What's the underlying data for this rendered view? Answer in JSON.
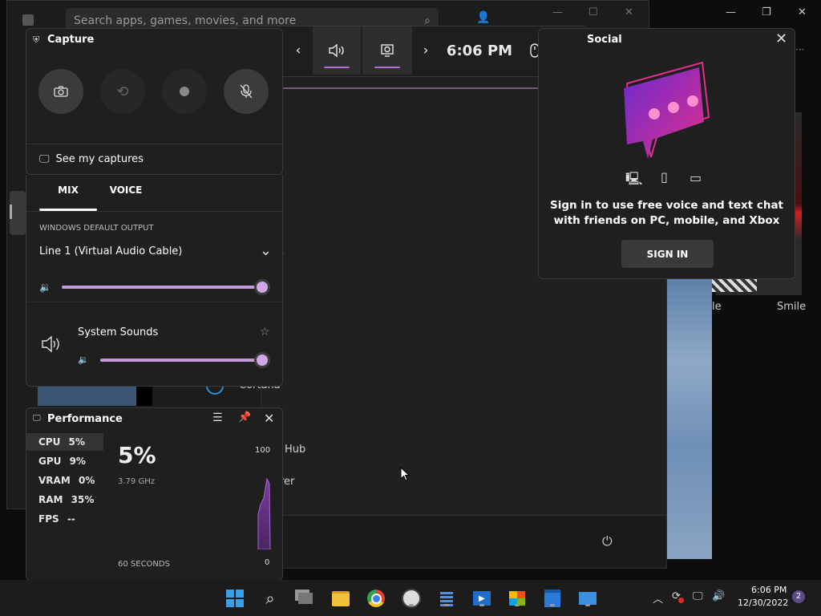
{
  "background": {
    "search_placeholder": "Search apps, games, movies, and more",
    "search_tab_fragment": "earch",
    "side_item_fragment": "r",
    "cortana_fragment": "Cortana",
    "hub_fragment": "Hub",
    "explorer_fragment": "rer",
    "thumb_label_1": "le",
    "thumb_label_2": "Smile"
  },
  "gamebar": {
    "time": "6:06 PM",
    "widgets": [
      {
        "name": "widget-menu",
        "icon": "widget-menu-icon"
      },
      {
        "name": "previous",
        "icon": "chevron-left-icon"
      },
      {
        "name": "audio",
        "icon": "speaker-icon",
        "active": true
      },
      {
        "name": "capture",
        "icon": "capture-icon",
        "active": true
      },
      {
        "name": "next",
        "icon": "chevron-right-icon"
      },
      {
        "name": "mouse",
        "icon": "mouse-icon"
      },
      {
        "name": "settings",
        "icon": "gear-icon"
      }
    ]
  },
  "capture": {
    "title": "Capture",
    "see_captures": "See my captures"
  },
  "audio": {
    "tabs": [
      "MIX",
      "VOICE"
    ],
    "active_tab": "MIX",
    "section_label": "WINDOWS DEFAULT OUTPUT",
    "device": "Line 1 (Virtual Audio Cable)",
    "master_volume": 1.0,
    "apps": [
      {
        "name": "System Sounds",
        "volume": 1.0
      }
    ]
  },
  "performance": {
    "title": "Performance",
    "metrics": [
      {
        "label": "CPU",
        "value": "5%"
      },
      {
        "label": "GPU",
        "value": "9%"
      },
      {
        "label": "VRAM",
        "value": "0%"
      },
      {
        "label": "RAM",
        "value": "35%"
      },
      {
        "label": "FPS",
        "value": "--"
      }
    ],
    "big_value": "5%",
    "clock": "3.79 GHz",
    "y_max": "100",
    "y_min": "0",
    "x_label": "60 SECONDS"
  },
  "social": {
    "title": "Social",
    "message_line1": "Sign in to use free voice and text chat",
    "message_line2": "with friends on PC, mobile, and Xbox",
    "sign_in": "SIGN IN"
  },
  "taskbar": {
    "time": "6:06 PM",
    "date": "12/30/2022",
    "notification_count": "2",
    "apps": [
      "start",
      "search",
      "task-view",
      "file-explorer",
      "chrome",
      "clock",
      "calculator",
      "media-player",
      "store",
      "calendar",
      "mail"
    ]
  },
  "colors": {
    "accent": "#b06fd8",
    "slider": "#c79bd9",
    "panel": "#1f1f1f"
  }
}
